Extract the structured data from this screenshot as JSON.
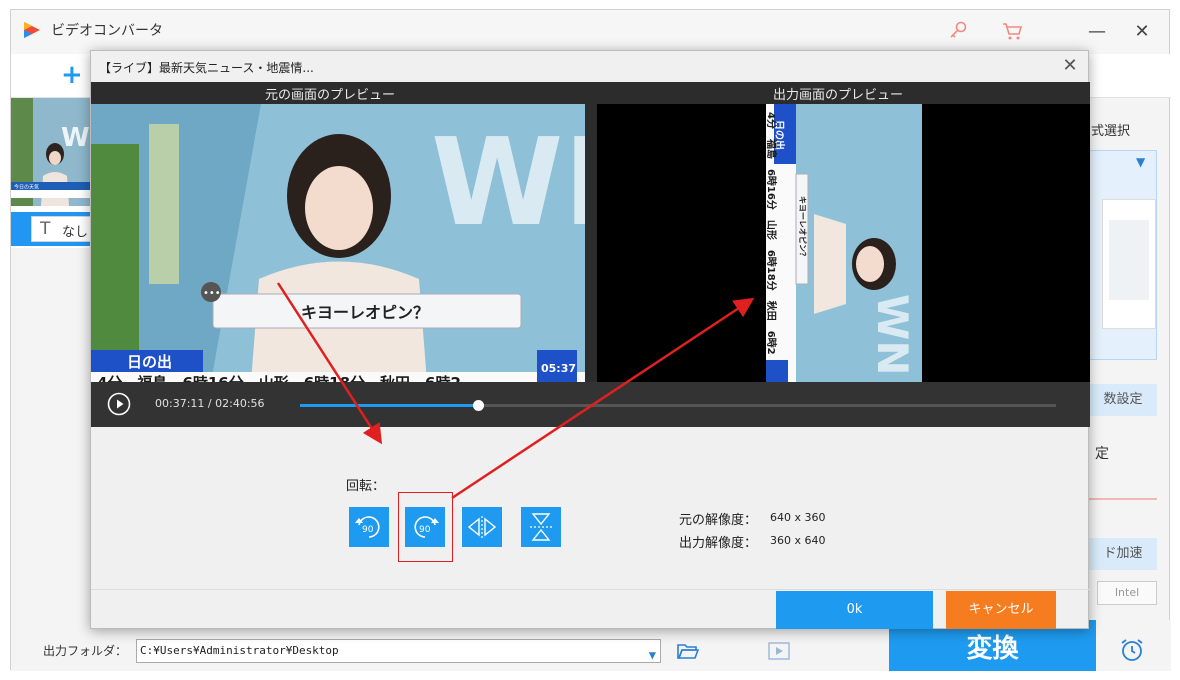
{
  "app": {
    "title": "ビデオコンバータ",
    "window_controls": [
      "—",
      "✕"
    ],
    "add_symbol": "+"
  },
  "left_panel": {
    "thumbnail_caption": "今日の天気",
    "subtitle_none": "なし",
    "subtitle_icon": "T"
  },
  "right_panel": {
    "format_select_label": "式選択",
    "param_settings": "数設定",
    "edit_settings": "定",
    "hw_accel": "ド加速",
    "intel_label": "Intel"
  },
  "output": {
    "label": "出力フォルダ：",
    "path": "C:¥Users¥Administrator¥Desktop",
    "dropdown_icon": "▼"
  },
  "convert_button": "変換",
  "dialog": {
    "title": "【ライブ】最新天気ニュース・地震情...",
    "close_icon": "✕",
    "source_preview_label": "元の画面のプレビュー",
    "output_preview_label": "出力画面のプレビュー",
    "current_time": "00:37:11",
    "separator": "/",
    "total_time": "02:40:56",
    "seek_progress": 0.235,
    "rotate_label": "回転：",
    "rotate_buttons": [
      {
        "name": "rotate-ccw-90",
        "glyph": "90"
      },
      {
        "name": "rotate-cw-90",
        "glyph": "90"
      },
      {
        "name": "flip-horizontal",
        "glyph": ""
      },
      {
        "name": "flip-vertical",
        "glyph": ""
      }
    ],
    "source_resolution_label": "元の解像度：",
    "source_resolution": "640 x 360",
    "output_resolution_label": "出力解像度：",
    "output_resolution": "360 x 640",
    "ok_label": "0k",
    "cancel_label": "キャンセル"
  },
  "video_overlay": {
    "caption_bubble": "キヨーレオピン？",
    "sunrise_header": "日の出",
    "ticker": "4分　福島　6時16分　山形　6時18分　秋田　6時2",
    "clock": "05:37",
    "logo": "WN"
  },
  "colors": {
    "accent_blue": "#1e9bf0",
    "cancel_orange": "#f57c1f",
    "annotation_red": "#e02020"
  }
}
